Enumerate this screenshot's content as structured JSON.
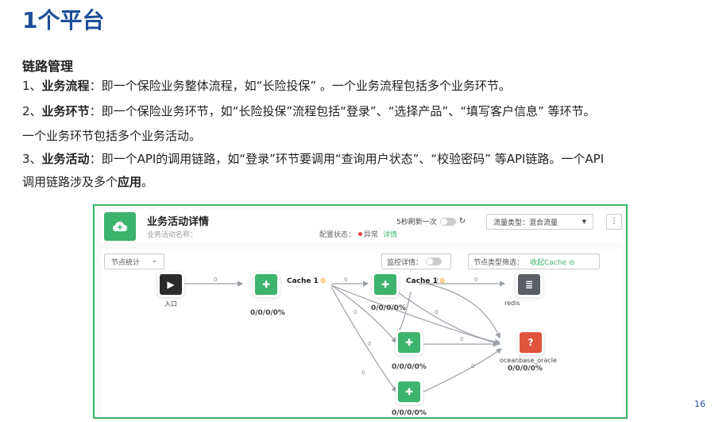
{
  "slide": {
    "title": "1个平台",
    "section": "链路管理",
    "p1_prefix": "1、",
    "p1_bold": "业务流程",
    "p1_text": "：即一个保险业务整体流程，如“长险投保” 。一个业务流程包括多个业务环节。",
    "p2_prefix": "2、",
    "p2_bold": "业务环节",
    "p2_text": "：即一个保险业务环节，如“长险投保”流程包括“登录”、“选择产品”、“填写客户信息” 等环节。",
    "p2_line2": "一个业务环节包括多个业务活动。",
    "p3_prefix": "3、",
    "p3_bold": "业务活动",
    "p3_text": "：即一个API的调用链路，如“登录”环节要调用“查询用户状态”、“校验密码” 等API链路。一个API",
    "p3_line2": "调用链路涉及多个",
    "p3_line2_bold": "应用",
    "p3_line2_end": "。",
    "page_number": "16"
  },
  "screenshot": {
    "title": "业务活动详情",
    "subtitle": "业务活动名称：",
    "config_label": "配置状态：",
    "config_status": "异常",
    "config_link": "详情",
    "refresh_label": "5秒刷新一次",
    "traffic_select": "流量类型：混合流量",
    "more": "⋮",
    "node_stats": "节点统计",
    "monitor_label": "监控详情：",
    "filter_label": "节点类型筛选：",
    "filter_collapse": "收起Cache ⊖",
    "nodes": {
      "entry_label": "入口",
      "app1_value": "0/0/0/0%",
      "app2_value": "0/0/0/0%",
      "app3_value": "0/0/0/0%",
      "app4_value": "0/0/0/0%",
      "redis_label": "redis",
      "oracle_label": "oceanbase_oracle",
      "oracle_value": "0/0/0/0%",
      "cache1": "Cache 1",
      "cache2": "Cache 1",
      "edge_zero": "0"
    }
  },
  "colors": {
    "title_blue": "#1f4e9a",
    "accent_green": "#3db46d",
    "error_red": "#e0533c"
  }
}
